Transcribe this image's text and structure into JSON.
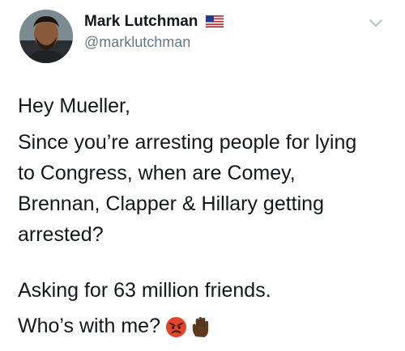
{
  "user": {
    "display_name": "Mark Lutchman",
    "handle": "@marklutchman",
    "flag_icon": "us-flag-icon"
  },
  "tweet": {
    "greeting": "Hey Mueller,",
    "question_lines": [
      "Since you’re arresting people for lying",
      "to Congress, when are Comey,",
      "Brennan, Clapper & Hillary getting",
      "arrested?"
    ],
    "asking": "Asking for 63 million friends.",
    "closing": "Who’s with me?",
    "emojis": [
      "angry-face-emoji",
      "raised-hand-emoji"
    ]
  },
  "colors": {
    "text": "#14171a",
    "secondary": "#657786",
    "chevron": "#aab8c2"
  }
}
